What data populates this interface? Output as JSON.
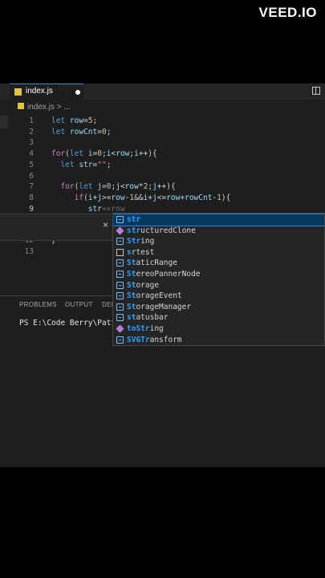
{
  "watermark": "VEED.IO",
  "tab": {
    "filename": "index.js"
  },
  "breadcrumb": {
    "file": "index.js",
    "trail": "> ..."
  },
  "code_lines": [
    {
      "num": "1",
      "tokens": [
        [
          "kw",
          "let"
        ],
        [
          "pun",
          " "
        ],
        [
          "var",
          "row"
        ],
        [
          "pun",
          "="
        ],
        [
          "num",
          "5"
        ],
        [
          "pun",
          ";"
        ]
      ]
    },
    {
      "num": "2",
      "tokens": [
        [
          "kw",
          "let"
        ],
        [
          "pun",
          " "
        ],
        [
          "var",
          "rowCnt"
        ],
        [
          "pun",
          "="
        ],
        [
          "num",
          "0"
        ],
        [
          "pun",
          ";"
        ]
      ]
    },
    {
      "num": "3",
      "tokens": []
    },
    {
      "num": "4",
      "tokens": [
        [
          "ctl",
          "for"
        ],
        [
          "pun",
          "("
        ],
        [
          "kw",
          "let"
        ],
        [
          "pun",
          " "
        ],
        [
          "var",
          "i"
        ],
        [
          "pun",
          "="
        ],
        [
          "num",
          "0"
        ],
        [
          "pun",
          ";"
        ],
        [
          "var",
          "i"
        ],
        [
          "pun",
          "<"
        ],
        [
          "var",
          "row"
        ],
        [
          "pun",
          ";"
        ],
        [
          "var",
          "i"
        ],
        [
          "pun",
          "++){"
        ]
      ]
    },
    {
      "num": "5",
      "tokens": [
        [
          "pun",
          "  "
        ],
        [
          "kw",
          "let"
        ],
        [
          "pun",
          " "
        ],
        [
          "var",
          "str"
        ],
        [
          "pun",
          "="
        ],
        [
          "str",
          "\"\""
        ],
        [
          "pun",
          ";"
        ]
      ]
    },
    {
      "num": "6",
      "tokens": []
    },
    {
      "num": "7",
      "tokens": [
        [
          "pun",
          "  "
        ],
        [
          "ctl",
          "for"
        ],
        [
          "pun",
          "("
        ],
        [
          "kw",
          "let"
        ],
        [
          "pun",
          " "
        ],
        [
          "var",
          "j"
        ],
        [
          "pun",
          "="
        ],
        [
          "num",
          "0"
        ],
        [
          "pun",
          ";"
        ],
        [
          "var",
          "j"
        ],
        [
          "pun",
          "<"
        ],
        [
          "var",
          "row"
        ],
        [
          "pun",
          "*"
        ],
        [
          "num",
          "2"
        ],
        [
          "pun",
          ";"
        ],
        [
          "var",
          "j"
        ],
        [
          "pun",
          "++){"
        ]
      ]
    },
    {
      "num": "8",
      "tokens": [
        [
          "pun",
          "     "
        ],
        [
          "ctl",
          "if"
        ],
        [
          "pun",
          "("
        ],
        [
          "var",
          "i"
        ],
        [
          "pun",
          "+"
        ],
        [
          "var",
          "j"
        ],
        [
          "pun",
          ">="
        ],
        [
          "var",
          "row"
        ],
        [
          "pun",
          "-"
        ],
        [
          "num",
          "1"
        ],
        [
          "pun",
          "&&"
        ],
        [
          "var",
          "i"
        ],
        [
          "pun",
          "+"
        ],
        [
          "var",
          "j"
        ],
        [
          "pun",
          "<="
        ],
        [
          "var",
          "row"
        ],
        [
          "pun",
          "+"
        ],
        [
          "var",
          "rowCnt"
        ],
        [
          "pun",
          "-"
        ],
        [
          "num",
          "1"
        ],
        [
          "pun",
          "){"
        ]
      ]
    },
    {
      "num": "9",
      "tokens": [
        [
          "pun",
          "        "
        ],
        [
          "var",
          "str"
        ],
        [
          "ghost",
          "+=row"
        ]
      ]
    },
    {
      "num": "12",
      "tokens": [
        [
          "pun",
          "}"
        ]
      ]
    },
    {
      "num": "13",
      "tokens": []
    }
  ],
  "peek_close": "×",
  "suggestions": [
    {
      "match": "str",
      "rest": "",
      "icon": "variable-icon"
    },
    {
      "match": "str",
      "rest": "ucturedClone",
      "icon": "method-icon"
    },
    {
      "match": "Str",
      "rest": "ing",
      "icon": "variable-icon"
    },
    {
      "match": "s",
      "rest": "rtest",
      "icon": "text-icon"
    },
    {
      "match": "St",
      "rest": "aticRange",
      "icon": "variable-icon"
    },
    {
      "match": "St",
      "rest": "ereoPannerNode",
      "icon": "variable-icon"
    },
    {
      "match": "St",
      "rest": "orage",
      "icon": "variable-icon"
    },
    {
      "match": "St",
      "rest": "orageEvent",
      "icon": "variable-icon"
    },
    {
      "match": "St",
      "rest": "orageManager",
      "icon": "variable-icon"
    },
    {
      "match": "st",
      "rest": "atusbar",
      "icon": "variable-icon"
    },
    {
      "match": "toStr",
      "rest": "ing",
      "icon": "method-icon"
    },
    {
      "match": "SVGTr",
      "rest": "ansform",
      "icon": "variable-icon"
    }
  ],
  "panel": {
    "tabs": [
      "PROBLEMS",
      "OUTPUT",
      "DEBUG CONSOLE"
    ],
    "terminal": "PS E:\\Code Berry\\Patterns"
  }
}
